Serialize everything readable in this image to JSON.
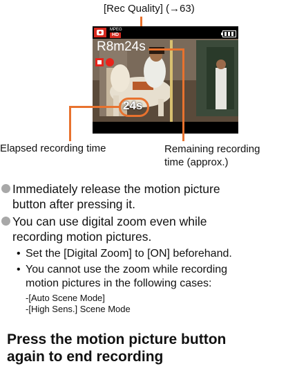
{
  "callout_top": "[Rec Quality] (→63)",
  "screen": {
    "mode_label_1": "MPEG",
    "mode_label_2": "HD",
    "remaining_time": "R8m24s",
    "elapsed_time": "24s",
    "camera_icon": "camera-icon",
    "battery_icon": "battery-icon",
    "rec_icon": "record-dot-icon",
    "colors": {
      "rec_red": "#e8231b",
      "callout_orange": "#e8722e"
    }
  },
  "captions": {
    "elapsed": "Elapsed recording time",
    "remaining_line1": "Remaining recording",
    "remaining_line2": "time (approx.)"
  },
  "bullets": [
    {
      "line1": "Immediately release the motion picture",
      "line2": "button after pressing it."
    },
    {
      "line1": "You can use digital zoom even while",
      "line2": "recording motion pictures."
    }
  ],
  "sub_bullets": [
    {
      "line1": "Set the [Digital Zoom] to [ON] beforehand."
    },
    {
      "line1": "You cannot use the zoom while recording",
      "line2": "motion pictures in the following cases:"
    }
  ],
  "cases": [
    "-[Auto Scene Mode]",
    "-[High Sens.] Scene Mode"
  ],
  "heading": {
    "line1": "Press the motion picture button",
    "line2": "again to end recording"
  }
}
